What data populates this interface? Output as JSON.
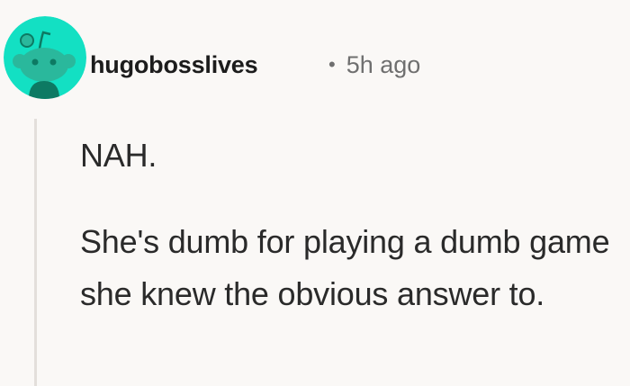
{
  "comment": {
    "username": "hugobosslives",
    "separator": "•",
    "timestamp": "5h ago",
    "avatar_icon": "reddit-snoo-avatar-icon",
    "paragraphs": [
      "NAH.",
      "She's dumb for playing a dumb game she knew the obvious answer to."
    ]
  },
  "colors": {
    "avatar_background": "#13e0c3",
    "avatar_figure": "#0d7a63",
    "page_background": "#faf8f6",
    "thread_line": "#e3dfdb"
  }
}
